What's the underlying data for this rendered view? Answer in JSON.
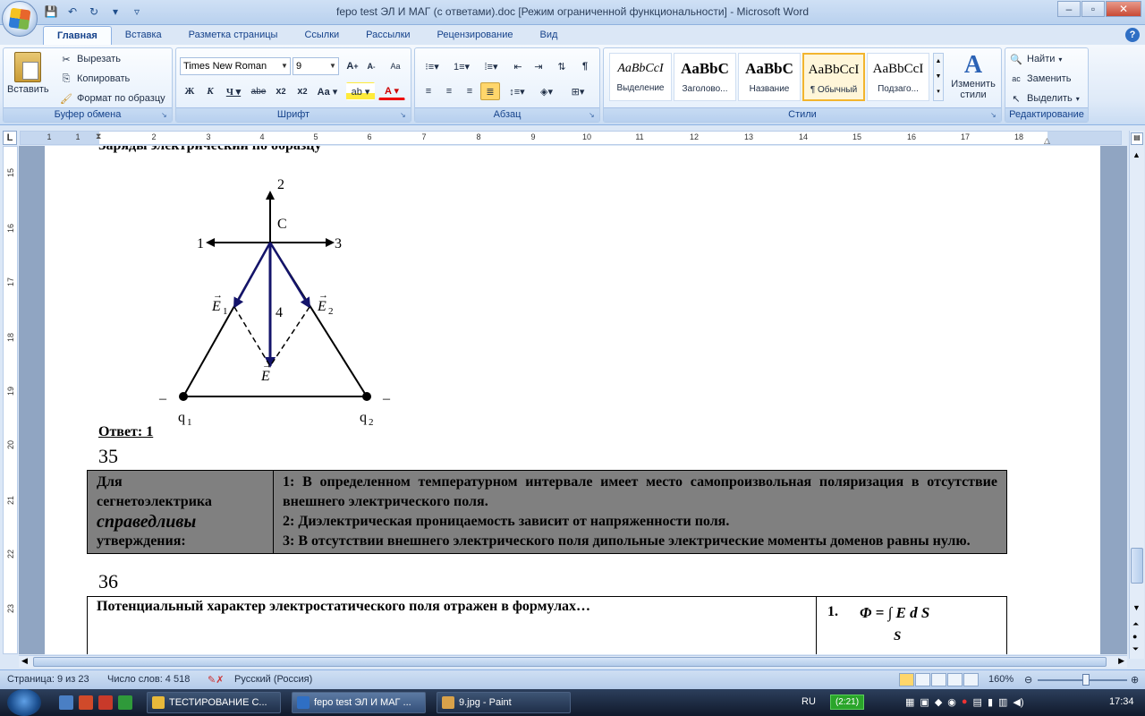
{
  "window": {
    "title": "fepo test ЭЛ И МАГ (с ответами).doc [Режим ограниченной функциональности] - Microsoft Word",
    "minimize": "–",
    "maximize": "▫",
    "close": "✕"
  },
  "tabs": [
    "Главная",
    "Вставка",
    "Разметка страницы",
    "Ссылки",
    "Рассылки",
    "Рецензирование",
    "Вид"
  ],
  "ribbon": {
    "clipboard": {
      "label": "Буфер обмена",
      "paste": "Вставить",
      "cut": "Вырезать",
      "copy": "Копировать",
      "format_painter": "Формат по образцу"
    },
    "font": {
      "label": "Шрифт",
      "font_name": "Times New Roman",
      "font_size": "9"
    },
    "paragraph": {
      "label": "Абзац"
    },
    "styles": {
      "label": "Стили",
      "items": [
        {
          "sample": "AaBbCcI",
          "name": "Выделение"
        },
        {
          "sample": "AaBbC",
          "name": "Заголово..."
        },
        {
          "sample": "AaBbC",
          "name": "Название"
        },
        {
          "sample": "AaBbCcI",
          "name": "¶ Обычный"
        },
        {
          "sample": "AaBbCcI",
          "name": "Подзаго..."
        }
      ],
      "change_styles": "Изменить стили"
    },
    "editing": {
      "label": "Редактирование",
      "find": "Найти",
      "replace": "Заменить",
      "select": "Выделить"
    }
  },
  "ruler": {
    "h_numbers": [
      "1",
      "1",
      "2",
      "3",
      "4",
      "5",
      "6",
      "7",
      "8",
      "9",
      "10",
      "11",
      "12",
      "13",
      "14",
      "15",
      "16",
      "17",
      "18"
    ],
    "v_numbers": [
      "15",
      "16",
      "17",
      "18",
      "19",
      "20",
      "21",
      "22",
      "23"
    ],
    "corner": "L"
  },
  "document": {
    "top_clipped_text": "Заряды электрический по образцу",
    "diagram": {
      "labels": {
        "top": "2",
        "left": "1",
        "right": "3",
        "down": "4",
        "point": "C",
        "e1": "E",
        "e1_sub": "1",
        "e2": "E",
        "e2_sub": "2",
        "e": "E",
        "q1": "q",
        "q1_sub": "1",
        "q2": "q",
        "q2_sub": "2",
        "q1_sign": "–",
        "q2_sign": "–"
      }
    },
    "answer": "Ответ: 1",
    "q35": {
      "number": "35",
      "left_line1": "Для",
      "left_line2": "сегнетоэлектрика",
      "left_line3": "справедливы",
      "left_line4": "утверждения:",
      "statement1": "1: В определенном температурном интервале имеет место самопроизвольная поляризация в отсутствие внешнего электрического поля.",
      "statement2": "2: Диэлектрическая проницаемость зависит от напряженности поля.",
      "statement3": "3: В отсутствии внешнего электрического поля дипольные электрические моменты доменов равны нулю."
    },
    "q36": {
      "number": "36",
      "question": "Потенциальный характер электростатического поля отражен в формулах…",
      "option_num": "1.",
      "formula": "Φ = ∫ E d S",
      "formula_sub": "S"
    }
  },
  "status": {
    "page": "Страница: 9 из 23",
    "words": "Число слов: 4 518",
    "language": "Русский (Россия)",
    "zoom": "160%"
  },
  "taskbar": {
    "tasks": [
      "ТЕСТИРОВАНИЕ С...",
      "fepo test ЭЛ И МАГ ...",
      "9.jpg - Paint"
    ],
    "lang": "RU",
    "battery": "(2:21)",
    "clock": "17:34"
  }
}
